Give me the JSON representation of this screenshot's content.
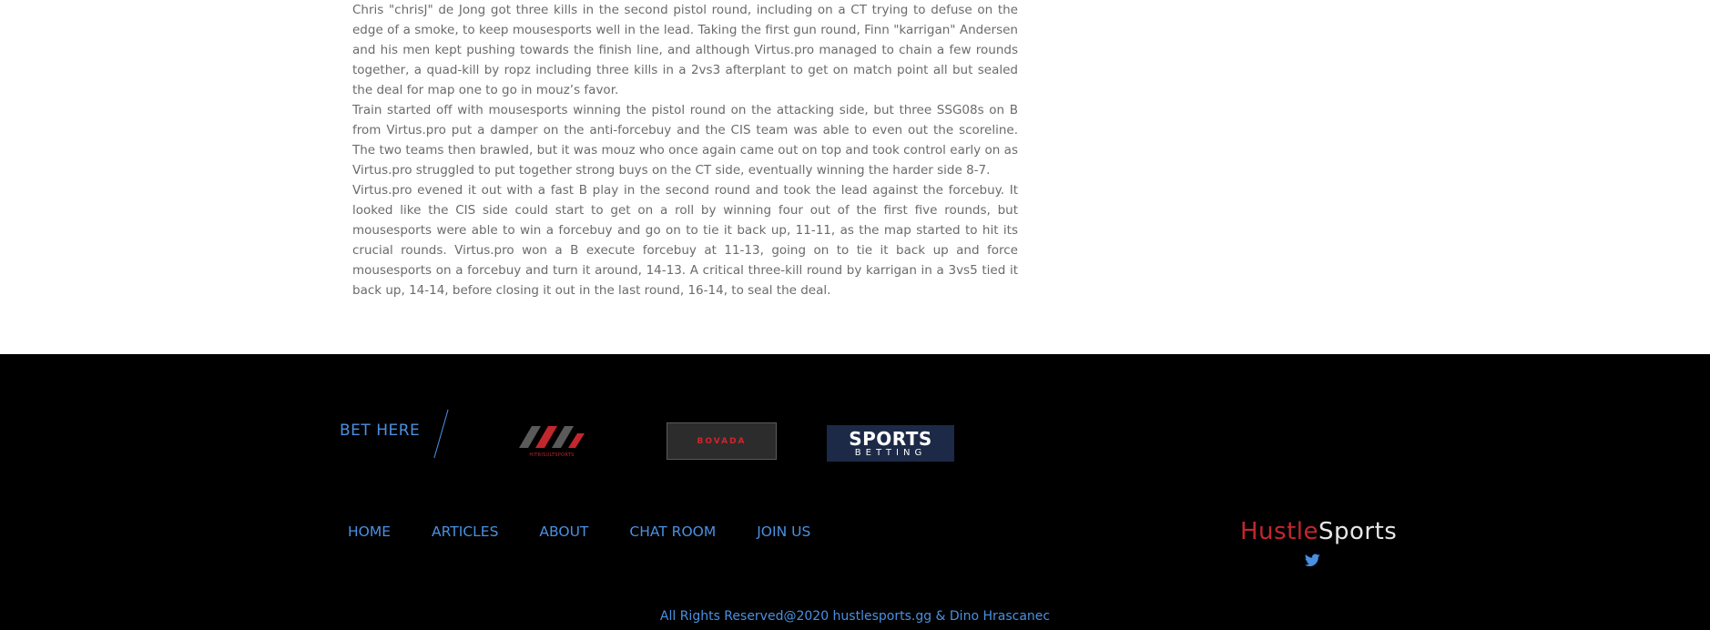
{
  "article": {
    "paragraphs": [
      "Chris \"chrisJ\" de Jong got three kills in the second pistol round, including on a CT trying to defuse on the edge of a smoke, to keep mousesports well in the lead. Taking the first gun round, Finn \"karrigan\" Andersen and his men kept pushing towards the finish line, and although Virtus.pro managed to chain a few rounds together, a quad-kill by ropz including three kills in a 2vs3 afterplant to get on match point all but sealed the deal for map one to go in mouz’s favor.",
      "Train started off with mousesports winning the pistol round on the attacking side, but three SSG08s on B from Virtus.pro put a damper on the anti-forcebuy and the CIS team was able to even out the scoreline. The two teams then brawled, but it was mouz who once again came out on top and took control early on as Virtus.pro struggled to put together strong buys on the CT side, eventually winning the harder side 8-7.",
      "Virtus.pro evened it out with a fast B play in the second round and took the lead against the forcebuy. It looked like the CIS side could start to get on a roll by winning four out of the first five rounds, but mousesports were able to win a forcebuy and go on to tie it back up, 11-11, as the map started to hit its crucial rounds. Virtus.pro won a B execute forcebuy at 11-13, going on to tie it back up and force mousesports on a forcebuy and turn it around, 14-13. A critical three-kill round by karrigan in a 3vs5 tied it back up, 14-14, before closing it out in the last round, 16-14, to seal the deal."
    ]
  },
  "footer": {
    "bet_here": "BET HERE",
    "sponsors": {
      "hustle_logo_sub": "HITRISULTSPORTS",
      "bovada": "BOVADA",
      "sportsbetting_top": "SPORTS",
      "sportsbetting_bottom": "BETTING"
    },
    "nav": [
      "HOME",
      "ARTICLES",
      "ABOUT",
      "CHAT ROOM",
      "JOIN US"
    ],
    "brand": {
      "part1": "Hustle",
      "part2": "Sports"
    },
    "copyright": "All Rights Reserved@2020 hustlesports.gg & Dino Hrascanec"
  },
  "colors": {
    "accent": "#4a90e2",
    "brand_red": "#c3272e",
    "footer_bg": "#000000",
    "text": "#6b6b6b"
  },
  "icons": [
    "hitrisult-logo-icon",
    "twitter-icon"
  ]
}
